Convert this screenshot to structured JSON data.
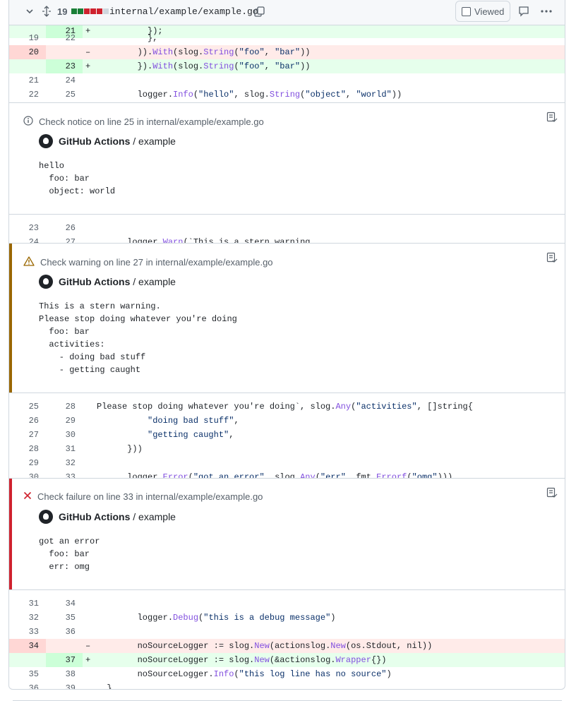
{
  "file_header": {
    "changed_count": "19",
    "diffstat_colors": [
      "#1a7f37",
      "#1a7f37",
      "#cf222e",
      "#cf222e",
      "#cf222e",
      "#d0d7de"
    ],
    "file_path": "internal/example/example.go",
    "viewed_label": "Viewed",
    "icons": [
      "chevron-down-icon",
      "expand-icon",
      "copy-icon",
      "comment-icon",
      "kebab-icon"
    ]
  },
  "hunks": {
    "partial_top": {
      "new": "21",
      "mark": "+",
      "code": "          });"
    },
    "block1": [
      {
        "old": "19",
        "new": "22",
        "mark": "",
        "type": "ctx",
        "code": "          },"
      },
      {
        "old": "20",
        "new": "",
        "mark": "–",
        "type": "del",
        "code": "        )).With(slog.String(\"foo\", \"bar\"))"
      },
      {
        "old": "",
        "new": "23",
        "mark": "+",
        "type": "add",
        "code": "        }).With(slog.String(\"foo\", \"bar\"))"
      },
      {
        "old": "21",
        "new": "24",
        "mark": "",
        "type": "ctx",
        "code": ""
      },
      {
        "old": "22",
        "new": "25",
        "mark": "",
        "type": "ctx",
        "code": "        logger.Info(\"hello\", slog.String(\"object\", \"world\"))"
      }
    ],
    "block2": [
      {
        "old": "23",
        "new": "26",
        "mark": "",
        "type": "ctx",
        "code": ""
      },
      {
        "old": "24",
        "new": "27",
        "mark": "",
        "type": "ctx",
        "code": "      logger.Warn(`This is a stern warning."
      }
    ],
    "block3": [
      {
        "old": "25",
        "new": "28",
        "mark": "",
        "type": "ctx",
        "code": "Please stop doing whatever you're doing`, slog.Any(\"activities\", []string{"
      },
      {
        "old": "26",
        "new": "29",
        "mark": "",
        "type": "ctx",
        "code": "          \"doing bad stuff\","
      },
      {
        "old": "27",
        "new": "30",
        "mark": "",
        "type": "ctx",
        "code": "          \"getting caught\","
      },
      {
        "old": "28",
        "new": "31",
        "mark": "",
        "type": "ctx",
        "code": "      }))"
      },
      {
        "old": "29",
        "new": "32",
        "mark": "",
        "type": "ctx",
        "code": ""
      },
      {
        "old": "30",
        "new": "33",
        "mark": "",
        "type": "ctx",
        "code": "      logger.Error(\"got an error\", slog.Any(\"err\", fmt.Errorf(\"omg\")))"
      }
    ],
    "block4": [
      {
        "old": "31",
        "new": "34",
        "mark": "",
        "type": "ctx",
        "code": ""
      },
      {
        "old": "32",
        "new": "35",
        "mark": "",
        "type": "ctx",
        "code": "        logger.Debug(\"this is a debug message\")"
      },
      {
        "old": "33",
        "new": "36",
        "mark": "",
        "type": "ctx",
        "code": ""
      },
      {
        "old": "34",
        "new": "",
        "mark": "–",
        "type": "del",
        "code": "        noSourceLogger := slog.New(actionslog.New(os.Stdout, nil))"
      },
      {
        "old": "",
        "new": "37",
        "mark": "+",
        "type": "add",
        "code": "        noSourceLogger := slog.New(&actionslog.Wrapper{})"
      },
      {
        "old": "35",
        "new": "38",
        "mark": "",
        "type": "ctx",
        "code": "        noSourceLogger.Info(\"this log line has no source\")"
      },
      {
        "old": "36",
        "new": "39",
        "mark": "",
        "type": "ctx",
        "code": "  }"
      }
    ]
  },
  "annotations": {
    "notice": {
      "title": "Check notice on line 25 in internal/example/example.go",
      "source_app": "GitHub Actions",
      "source_sep": " / ",
      "source_job": "example",
      "message": "hello\n  foo: bar\n  object: world",
      "icon": "info-icon",
      "accent": "#ffffff"
    },
    "warning": {
      "title": "Check warning on line 27 in internal/example/example.go",
      "source_app": "GitHub Actions",
      "source_sep": " / ",
      "source_job": "example",
      "message": "This is a stern warning.\nPlease stop doing whatever you're doing\n  foo: bar\n  activities:\n    - doing bad stuff\n    - getting caught",
      "icon": "alert-icon",
      "accent": "#9a6700"
    },
    "failure": {
      "title": "Check failure on line 33 in internal/example/example.go",
      "source_app": "GitHub Actions",
      "source_sep": " / ",
      "source_job": "example",
      "message": "got an error\n  foo: bar\n  err: omg",
      "icon": "x-icon",
      "accent": "#cf222e"
    }
  }
}
